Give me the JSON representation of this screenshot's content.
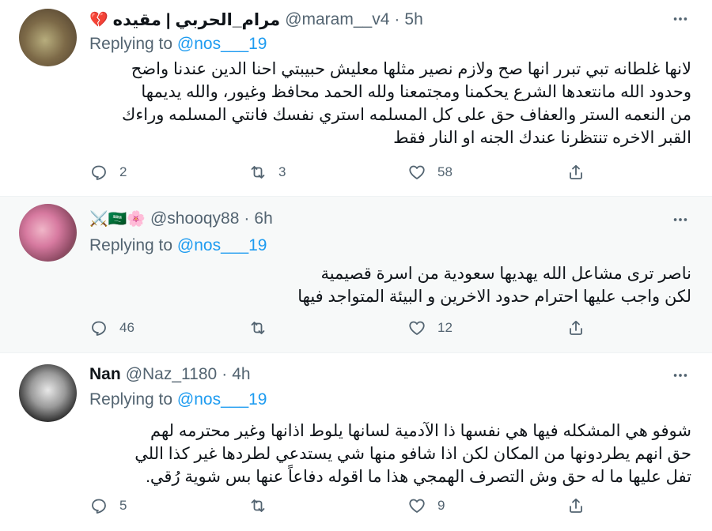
{
  "tweets": [
    {
      "name": "مرام_الحربي | مقيده",
      "name_emoji": "💔",
      "handle": "@maram__v4",
      "dot": "·",
      "time": "5h",
      "replying_prefix": "Replying to",
      "replying_to": "@nos___19",
      "body": [
        "لانها غلطانه تبي تبرر انها صح ولازم نصير مثلها معليش حبيبتي احنا الدين عندنا واضح",
        "وحدود الله مانتعدها الشرع يحكمنا ومجتمعنا ولله الحمد محافظ وغيور، والله يديمها",
        "من النعمه الستر والعفاف حق على كل المسلمه استري نفسك فانتي المسلمه وراءك",
        "القبر الاخره تنتظرنا عندك الجنه او النار فقط"
      ],
      "reply_count": "2",
      "retweet_count": "3",
      "like_count": "58"
    },
    {
      "name": "",
      "name_emoji": "⚔️🇸🇦🌸",
      "handle": "@shooqy88",
      "dot": "·",
      "time": "6h",
      "replying_prefix": "Replying to",
      "replying_to": "@nos___19",
      "body": [
        "ناصر ترى مشاعل الله يهديها سعودية من اسرة قصيمية",
        "لكن واجب عليها احترام حدود الاخرين و البيئة المتواجد فيها"
      ],
      "reply_count": "46",
      "retweet_count": "",
      "like_count": "12"
    },
    {
      "name": "Nan",
      "name_emoji": "",
      "handle": "@Naz_1180",
      "dot": "·",
      "time": "4h",
      "replying_prefix": "Replying to",
      "replying_to": "@nos___19",
      "body": [
        "شوفو هي المشكله فيها هي نفسها ذا الآدمية لسانها يلوط اذانها وغير محترمه لهم",
        "حق انهم يطردونها من المكان لكن اذا شافو منها شي يستدعي لطردها غير كذا اللي",
        "تفل عليها ما له حق وش التصرف الهمجي هذا ما اقوله دفاعاً عنها بس شوية رُقي."
      ],
      "reply_count": "5",
      "retweet_count": "",
      "like_count": "9"
    }
  ],
  "icons": {
    "more": "more-horizontal-icon",
    "reply": "reply-bubble-icon",
    "retweet": "retweet-arrows-icon",
    "like": "heart-icon",
    "share": "share-upload-icon"
  },
  "colors": {
    "accent": "#1d9bf0",
    "muted": "#536471",
    "text": "#0f1419"
  }
}
